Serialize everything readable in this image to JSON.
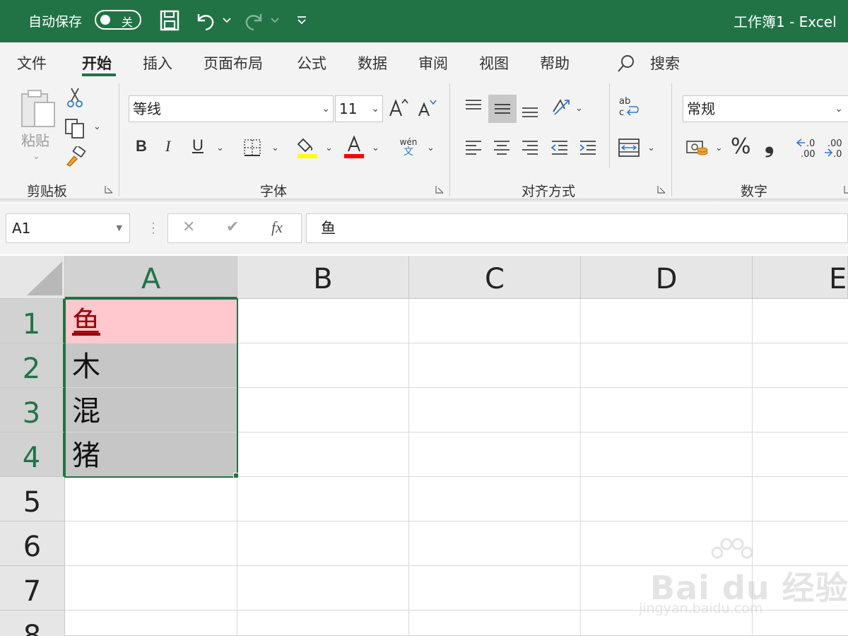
{
  "titlebar": {
    "autosave_label": "自动保存",
    "autosave_state": "关",
    "doc_title": "工作簿1  -  Excel",
    "bg_color": "#217346"
  },
  "tabs": {
    "items": [
      "文件",
      "开始",
      "插入",
      "页面布局",
      "公式",
      "数据",
      "审阅",
      "视图",
      "帮助"
    ],
    "active": "开始",
    "search_label": "搜索"
  },
  "ribbon": {
    "clipboard": {
      "paste_label": "粘贴",
      "group_label": "剪贴板"
    },
    "font": {
      "font_name": "等线",
      "font_size": "11",
      "bold": "B",
      "italic": "I",
      "underline": "U",
      "font_color_letter": "A",
      "phonetic_top": "wén",
      "phonetic_bottom": "文",
      "group_label": "字体",
      "highlight_color": "#ffff00",
      "font_color": "#ff0000"
    },
    "alignment": {
      "group_label": "对齐方式"
    },
    "number": {
      "format": "常规",
      "percent": "%",
      "comma": "❟",
      "group_label": "数字"
    }
  },
  "formula_bar": {
    "name_box": "A1",
    "cancel": "✕",
    "enter": "✔",
    "fx": "fx",
    "content": "鱼"
  },
  "grid": {
    "columns": [
      "A",
      "B",
      "C",
      "D",
      "E"
    ],
    "rows": [
      "1",
      "2",
      "3",
      "4",
      "5",
      "6",
      "7",
      "8"
    ],
    "cells": {
      "A1": "鱼",
      "A2": "木",
      "A3": "混",
      "A4": "猪"
    },
    "selection": "A1:A4",
    "accent": "#217346",
    "highlight_fill": "#ffc7ce",
    "highlight_text": "#9c0006"
  },
  "watermark": {
    "main": "Bai du 经验",
    "sub": "jingyan.baidu.com"
  }
}
